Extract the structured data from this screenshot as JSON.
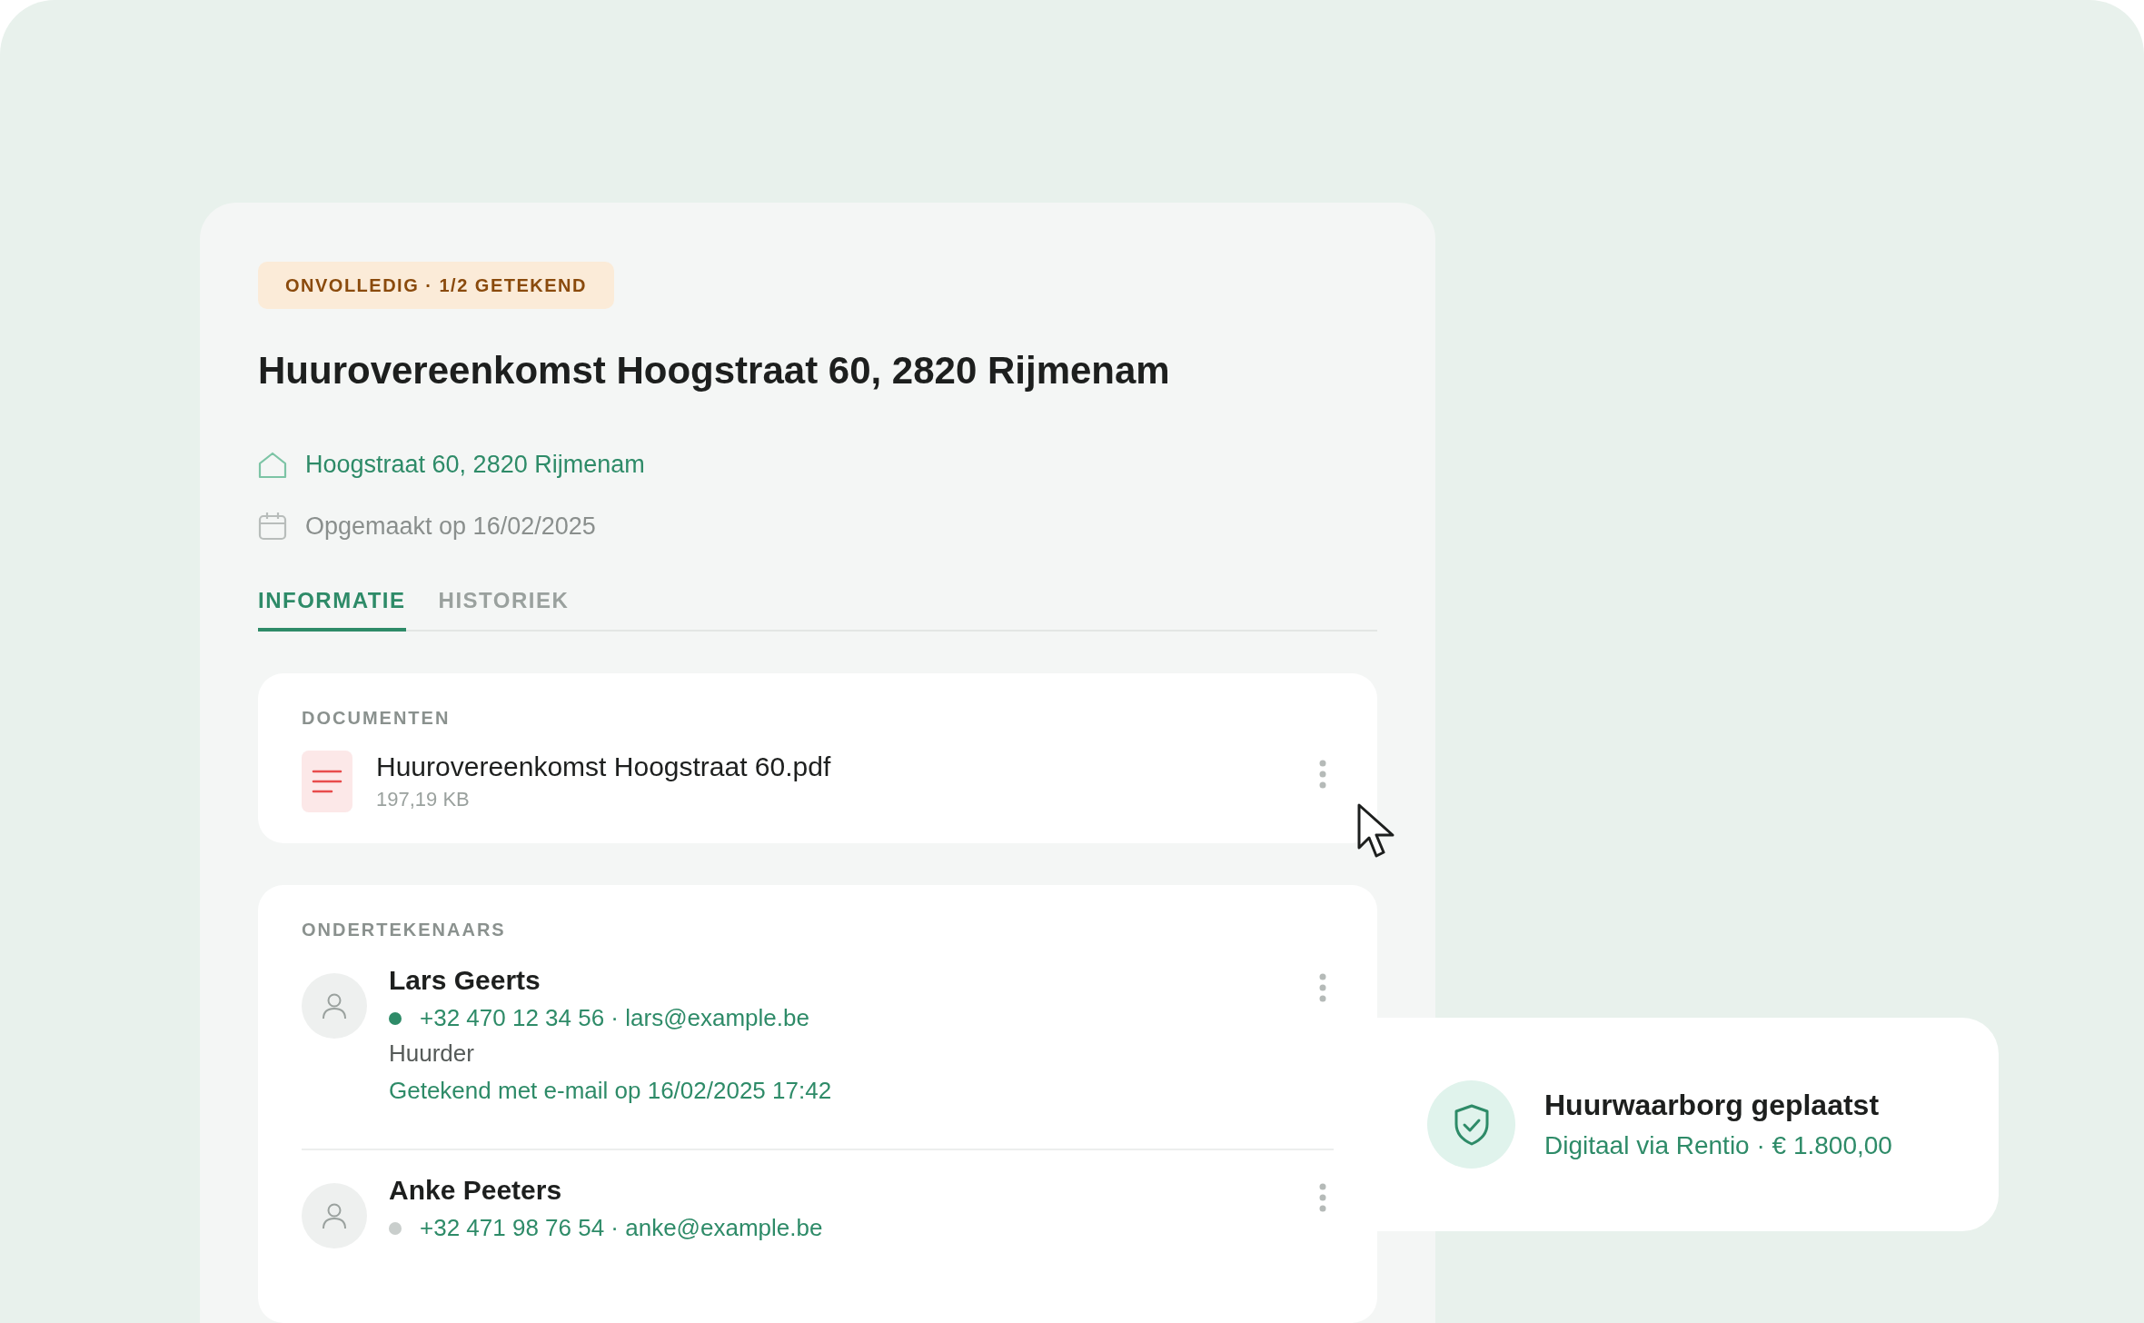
{
  "status_badge": "ONVOLLEDIG · 1/2 GETEKEND",
  "title": "Huurovereenkomst Hoogstraat 60, 2820 Rijmenam",
  "meta": [
    {
      "kind": "address",
      "text": "Hoogstraat 60, 2820 Rijmenam"
    },
    {
      "kind": "date",
      "text": "Opgemaakt op 16/02/2025"
    }
  ],
  "tabs": [
    {
      "label": "INFORMATIE",
      "selected": true
    },
    {
      "label": "HISTORIEK",
      "selected": false
    }
  ],
  "documents": {
    "heading": "DOCUMENTEN",
    "files": [
      {
        "name": "Huurovereenkomst Hoogstraat 60.pdf",
        "size": "197,19 KB"
      }
    ]
  },
  "signers": {
    "heading": "ONDERTEKENAARS",
    "people": [
      {
        "name": "Lars Geerts",
        "contact": "+32 470 12 34 56 · lars@example.be",
        "signed": true,
        "role": "Huurder",
        "signature": "Getekend met e-mail op 16/02/2025 17:42"
      },
      {
        "name": "Anke Peeters",
        "contact": "+32 471 98 76 54 · anke@example.be",
        "signed": false
      }
    ]
  },
  "toast": {
    "title": "Huurwaarborg geplaatst",
    "subtitle": "Digitaal via Rentio · € 1.800,00"
  }
}
